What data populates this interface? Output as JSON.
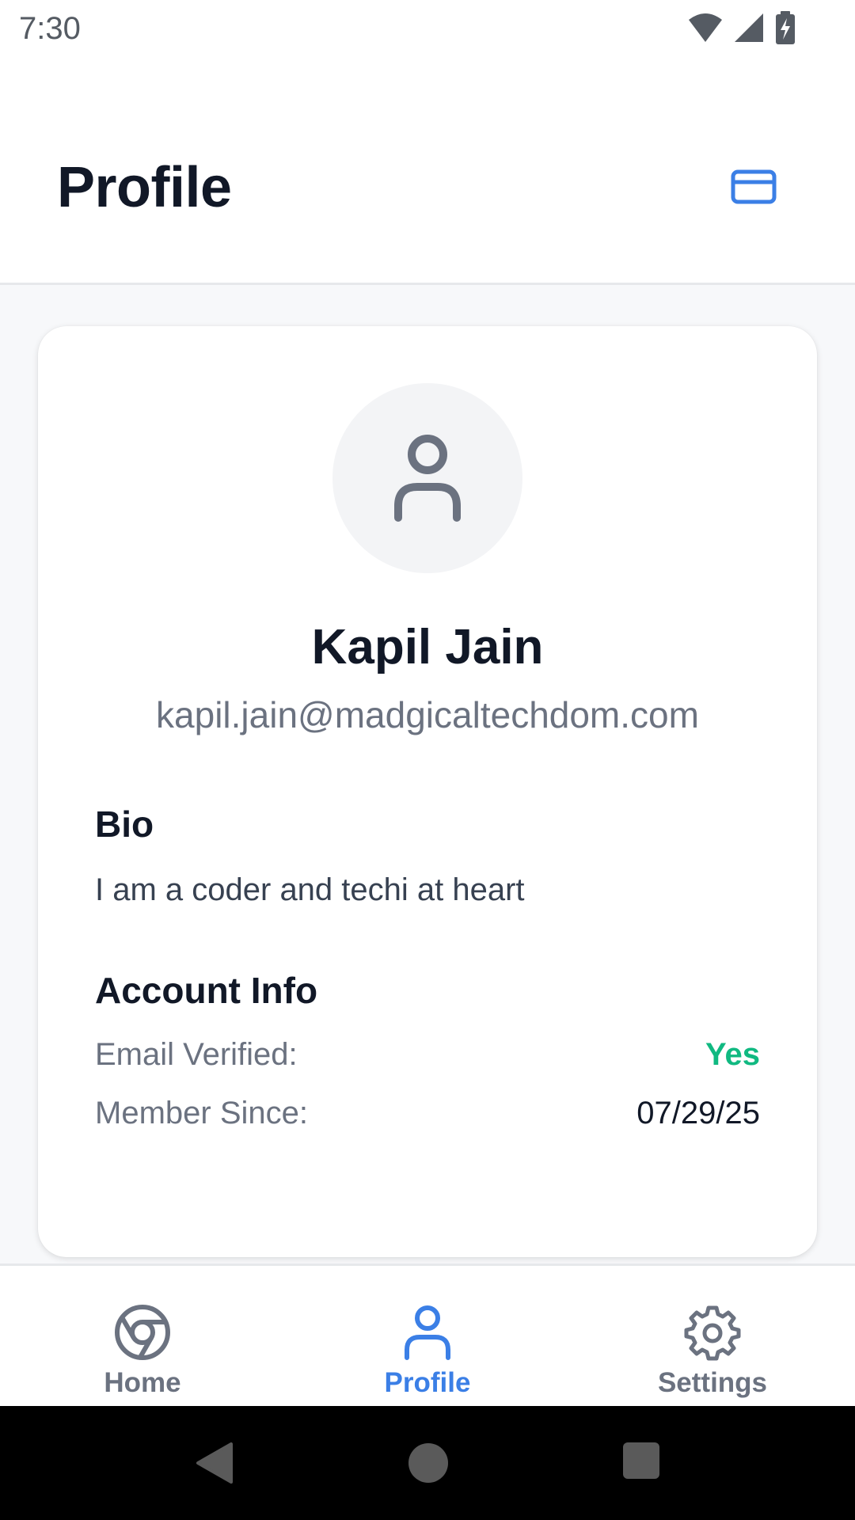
{
  "status_bar": {
    "time": "7:30"
  },
  "header": {
    "title": "Profile"
  },
  "profile": {
    "name": "Kapil Jain",
    "email": "kapil.jain@madgicaltechdom.com",
    "bio_title": "Bio",
    "bio_text": "I am a coder and techi at heart",
    "account_title": "Account Info",
    "account_rows": [
      {
        "label": "Email Verified:",
        "value": "Yes"
      },
      {
        "label": "Member Since:",
        "value": "07/29/25"
      }
    ]
  },
  "bottom_nav": {
    "items": [
      {
        "label": "Home",
        "icon": "chrome-icon",
        "active": false
      },
      {
        "label": "Profile",
        "icon": "user-icon",
        "active": true
      },
      {
        "label": "Settings",
        "icon": "gear-icon",
        "active": false
      }
    ]
  },
  "colors": {
    "accent": "#3b7fe6",
    "verified_green": "#10b981",
    "title_text": "#111827",
    "muted_text": "#6b7280"
  }
}
